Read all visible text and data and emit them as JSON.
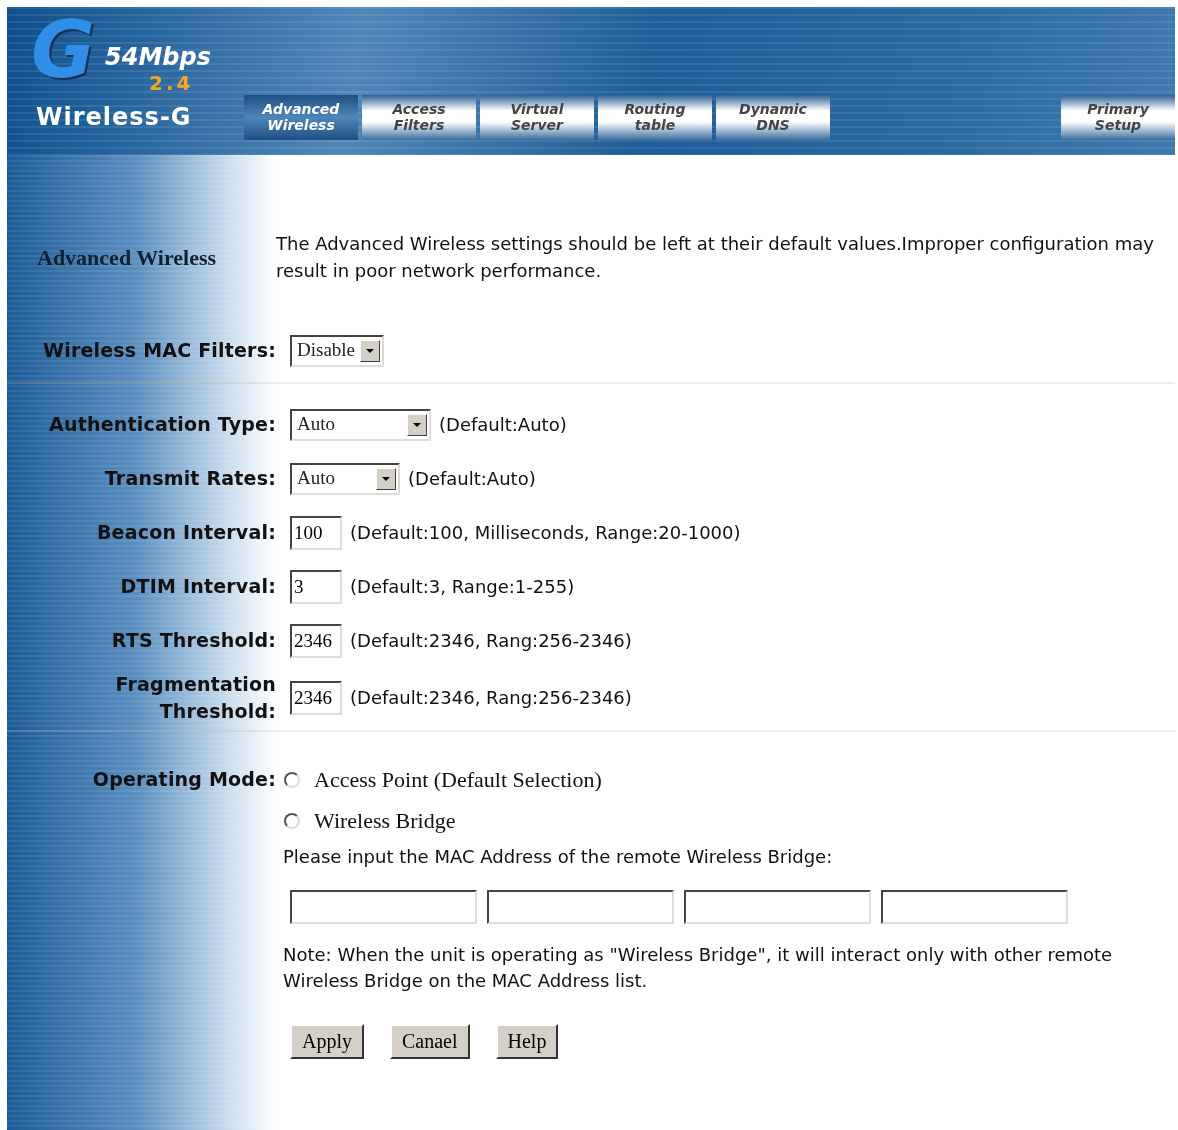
{
  "header": {
    "logo": {
      "letter": "G",
      "speed": "54Mbps",
      "band": "2.4",
      "name": "Wireless-G"
    },
    "tabs": [
      {
        "label": "Advanced Wireless",
        "selected": true
      },
      {
        "label": "Access Filters",
        "selected": false
      },
      {
        "label": "Virtual Server",
        "selected": false
      },
      {
        "label": "Routing table",
        "selected": false
      },
      {
        "label": "Dynamic DNS",
        "selected": false
      }
    ],
    "right_tab": {
      "label": "Primary Setup",
      "selected": false
    }
  },
  "intro": {
    "title": "Advanced Wireless",
    "text": "The Advanced Wireless settings should be left at their default values.Improper configuration may result in poor network performance."
  },
  "mac_filter": {
    "label": "Wireless MAC Filters:",
    "value": "Disable"
  },
  "settings": [
    {
      "kind": "select",
      "label": "Authentication Type:",
      "value": "Auto",
      "hint": "(Default:Auto)"
    },
    {
      "kind": "select",
      "label": "Transmit Rates:",
      "value": "Auto",
      "hint": "(Default:Auto)"
    },
    {
      "kind": "text",
      "label": "Beacon Interval:",
      "value": "100",
      "hint": "(Default:100, Milliseconds, Range:20-1000)"
    },
    {
      "kind": "text",
      "label": "DTIM Interval:",
      "value": "3",
      "hint": "(Default:3, Range:1-255)"
    },
    {
      "kind": "text",
      "label": "RTS Threshold:",
      "value": "2346",
      "hint": "(Default:2346, Rang:256-2346)"
    },
    {
      "kind": "text",
      "label": "Fragmentation Threshold:",
      "value": "2346",
      "hint": "(Default:2346, Rang:256-2346)"
    }
  ],
  "operating_mode": {
    "label": "Operating Mode:",
    "options": [
      {
        "label": "Access Point (Default Selection)",
        "selected": false
      },
      {
        "label": "Wireless Bridge",
        "selected": false
      }
    ],
    "prompt": "Please input the MAC Address of the remote Wireless Bridge:",
    "note": "Note: When the unit is operating as \"Wireless Bridge\", it will interact only with other remote Wireless Bridge on the MAC Address list."
  },
  "buttons": [
    "Apply",
    "Canael",
    "Help"
  ]
}
